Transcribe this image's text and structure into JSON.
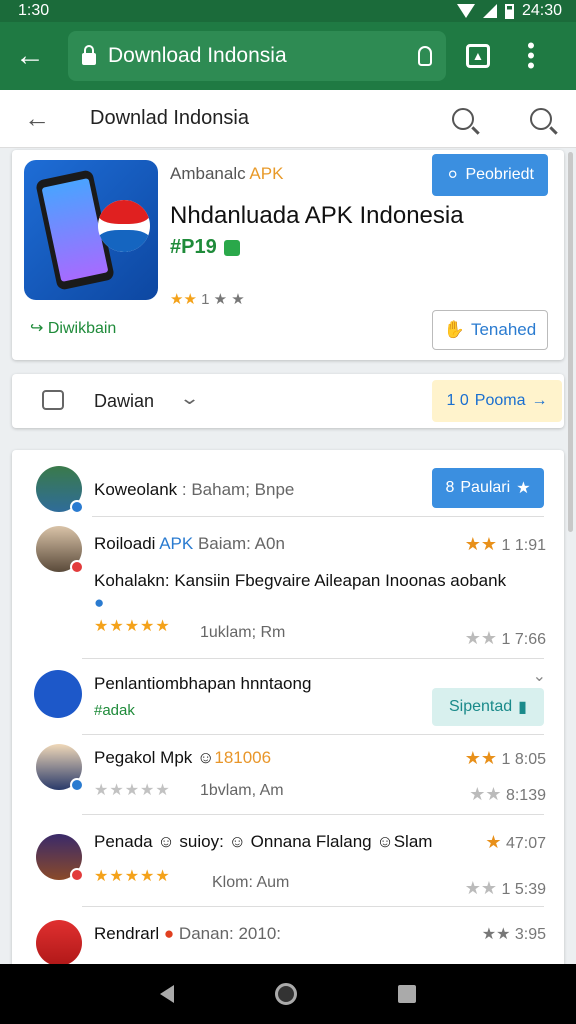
{
  "status_bar": {
    "time": "1:30",
    "right_time": "24:30"
  },
  "browser": {
    "url_text": "Download Indonsia"
  },
  "header": {
    "title": "Downlad Indonsia"
  },
  "app_card": {
    "subtitle_a": "Ambanalc ",
    "subtitle_b": "APK",
    "title": "Nhdanluada APK Indonesia",
    "price": "#P19",
    "rating_stars": "★★",
    "rating_text": "1 ★ ★",
    "downloads_link": "Diwikbain",
    "primary_button": "Peobriedt",
    "secondary_button": "Tenahed",
    "icon_color": "#1e6dd6"
  },
  "filter_bar": {
    "label": "Dawian",
    "cta_label": "Pooma"
  },
  "reviews": [
    {
      "name": "Koweolank",
      "name_muted": " : Baham; Bnpe",
      "button_label": "Paulari"
    },
    {
      "name": "Roiloadi",
      "name_blue": " APK",
      "name_muted": " Baiam: A0n",
      "right": "1 1:91",
      "text": "Kohalakn: Kansiin Fbegvaire Aileapan Inoonas aobank",
      "stars": "★★★★★",
      "meta": "1uklam; Rm",
      "right2": "1 7:66"
    },
    {
      "name": "Penlantiombhapan hnntaong",
      "tag": "#adak",
      "button_label": "Sipentad"
    },
    {
      "name": "Pegakol Mpk ",
      "name_orange": "181006",
      "right": "1 8:05",
      "stars": "★★★★★",
      "meta": "1bvlam, Am",
      "right2": "8:139"
    },
    {
      "name": "Penada ",
      "name_rest": " suioy: ",
      "name_rest2": " Onnana Flalang ",
      "name_rest3": "Slam",
      "right": "47:07",
      "stars": "★★★★★",
      "meta": "Klom: Aum",
      "right2": "1 5:39"
    },
    {
      "name": "Rendrarl ",
      "name_rest": " Danan: 2010:",
      "right": "★★ 3:95"
    }
  ]
}
